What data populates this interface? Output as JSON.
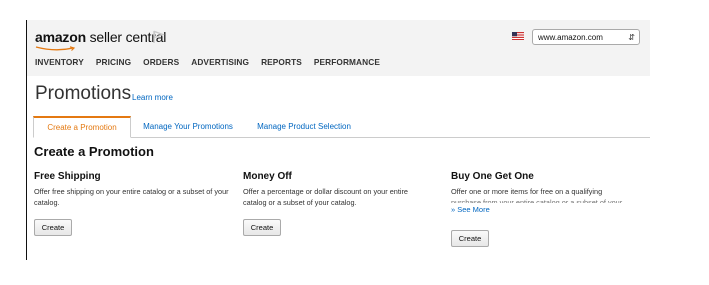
{
  "header": {
    "brand_amazon": "amazon",
    "brand_product": " seller central",
    "marketplace_selected": "www.amazon.com",
    "nav": [
      "INVENTORY",
      "PRICING",
      "ORDERS",
      "ADVERTISING",
      "REPORTS",
      "PERFORMANCE"
    ],
    "accent_color": "#e47911",
    "link_color": "#0066c0"
  },
  "page": {
    "title": "Promotions",
    "learn_more": "Learn more",
    "tabs": [
      {
        "label": "Create a Promotion",
        "active": true
      },
      {
        "label": "Manage Your Promotions",
        "active": false
      },
      {
        "label": "Manage Product Selection",
        "active": false
      }
    ],
    "section_title": "Create a Promotion"
  },
  "cards": [
    {
      "title": "Free Shipping",
      "desc": "Offer free shipping on your entire catalog or a subset of your catalog.",
      "button": "Create"
    },
    {
      "title": "Money Off",
      "desc": "Offer a percentage or dollar discount on your entire catalog or a subset of your catalog.",
      "button": "Create"
    },
    {
      "title": "Buy One Get One",
      "desc_line1": "Offer one or more items for free on a qualifying",
      "desc_line2": "purchase from your entire catalog or a subset of your",
      "see_more": "» See More",
      "button": "Create"
    }
  ]
}
